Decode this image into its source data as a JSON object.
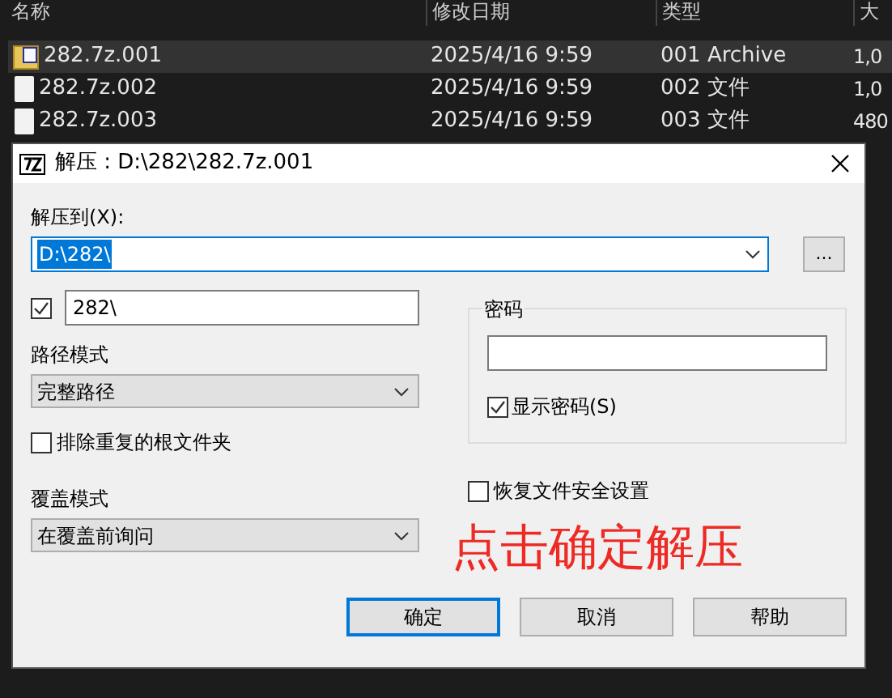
{
  "explorer": {
    "columns": [
      "名称",
      "修改日期",
      "类型",
      "大"
    ],
    "rows": [
      {
        "name": "282.7z.001",
        "date": "2025/4/16 9:59",
        "type": "001 Archive",
        "size": "1,0",
        "kind": "archive",
        "selected": true
      },
      {
        "name": "282.7z.002",
        "date": "2025/4/16 9:59",
        "type": "002 文件",
        "size": "1,0",
        "kind": "file",
        "selected": false
      },
      {
        "name": "282.7z.003",
        "date": "2025/4/16 9:59",
        "type": "003 文件",
        "size": "480",
        "kind": "file",
        "selected": false
      }
    ]
  },
  "dialog": {
    "title": "解压 : D:\\282\\282.7z.001",
    "extract_to": {
      "label": "解压到(X):",
      "value": "D:\\282\\",
      "text_selected": true
    },
    "browse_button": "...",
    "subfolder": {
      "checked": true,
      "value": "282\\"
    },
    "path_mode": {
      "label": "路径模式",
      "value": "完整路径"
    },
    "eliminate_duplicates": {
      "label": "排除重复的根文件夹",
      "checked": false
    },
    "overwrite_mode": {
      "label": "覆盖模式",
      "value": "在覆盖前询问"
    },
    "password": {
      "label": "密码",
      "show_password": {
        "label": "显示密码(S)",
        "checked": true
      }
    },
    "restore_security": {
      "label": "恢复文件安全设置",
      "checked": false
    },
    "annotation": "点击确定解压",
    "buttons": [
      {
        "label": "确定",
        "default": true
      },
      {
        "label": "取消",
        "default": false
      },
      {
        "label": "帮助",
        "default": false
      }
    ]
  }
}
